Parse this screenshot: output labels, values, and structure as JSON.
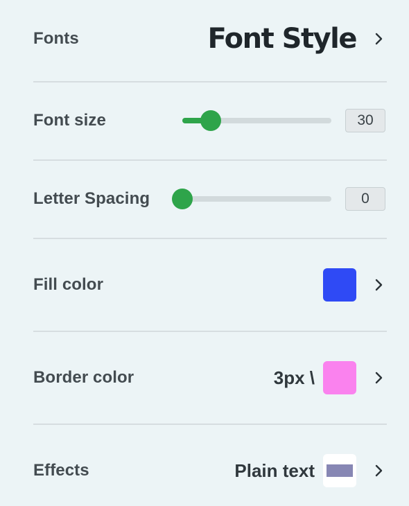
{
  "fonts": {
    "label": "Fonts",
    "value": "Font Style"
  },
  "font_size": {
    "label": "Font size",
    "value": "30",
    "slider_fraction": 0.19
  },
  "letter_spacing": {
    "label": "Letter Spacing",
    "value": "0",
    "slider_fraction": 0.0
  },
  "fill_color": {
    "label": "Fill color",
    "color": "#2f4af5"
  },
  "border_color": {
    "label": "Border color",
    "value": "3px \\",
    "color": "#fa82ee"
  },
  "effects": {
    "label": "Effects",
    "value": "Plain text",
    "preview_color": "#8787b4"
  },
  "colors": {
    "accent": "#2ea44a",
    "background": "#ecf4f6"
  },
  "icons": {
    "chevron": "chevron-right-icon"
  }
}
